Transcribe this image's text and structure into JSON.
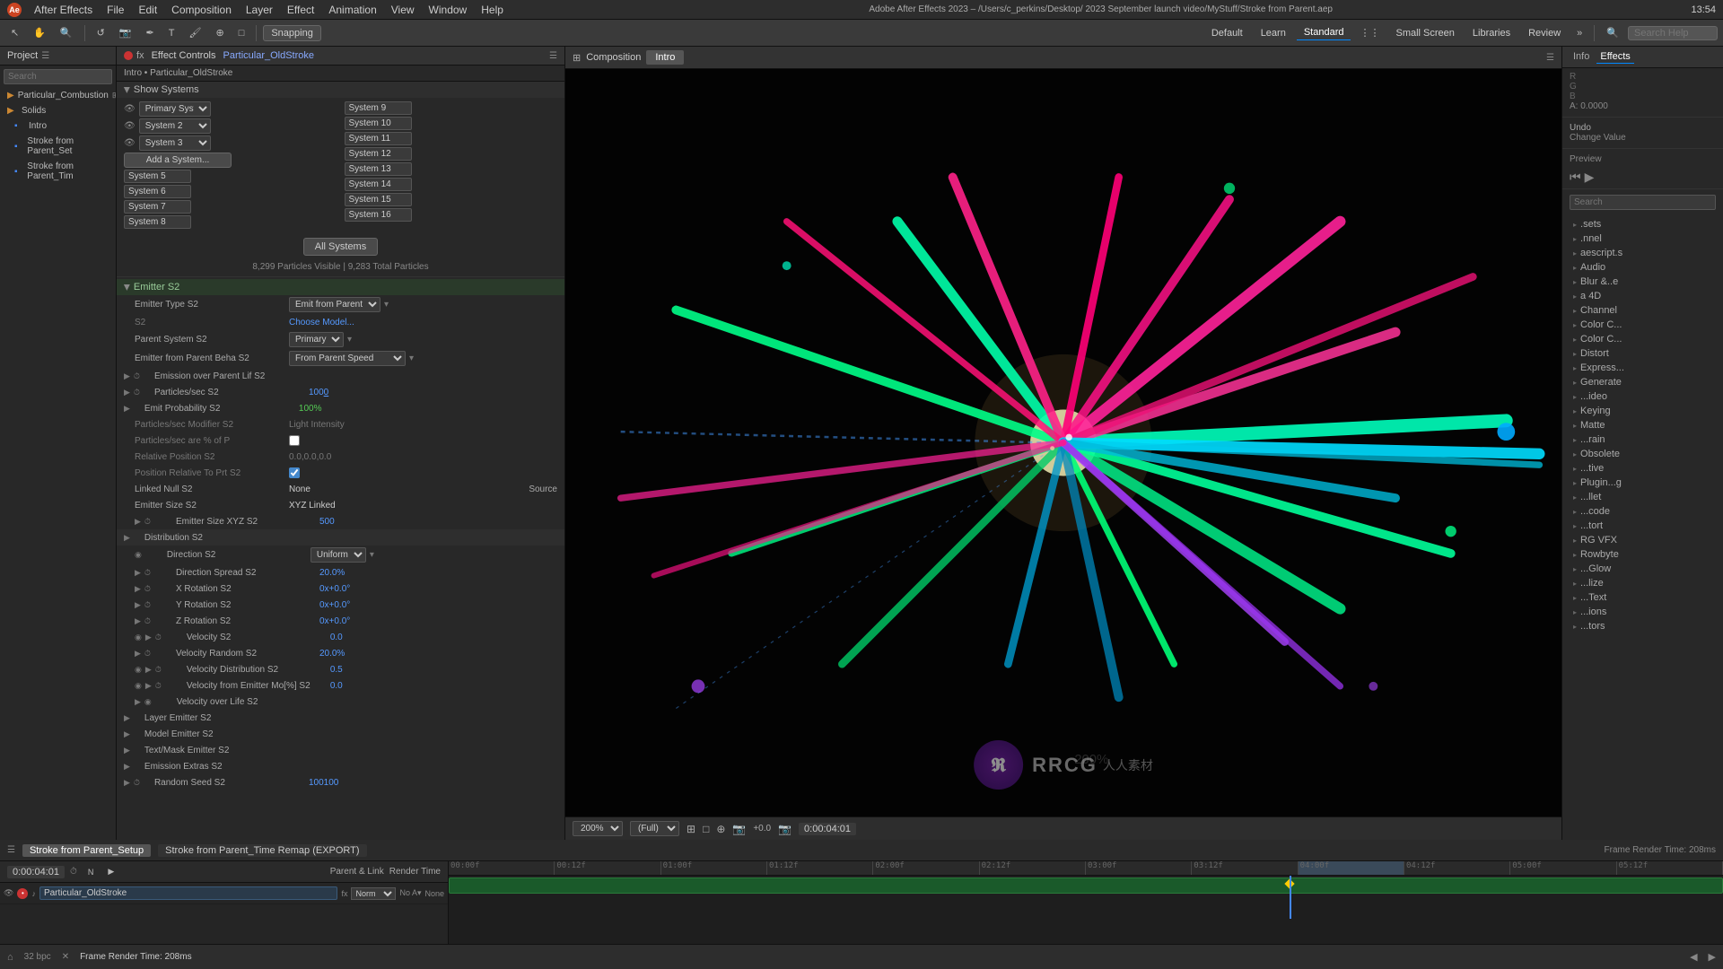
{
  "app": {
    "name": "Adobe After Effects 2023",
    "version": "AE",
    "title": "Adobe After Effects 2023 – /Users/c_perkins/Desktop/ 2023 September launch video/MyStuff/Stroke from Parent.aep",
    "time": "13:54"
  },
  "menubar": {
    "items": [
      "After Effects",
      "File",
      "Edit",
      "Composition",
      "Layer",
      "Effect",
      "Animation",
      "View",
      "Window",
      "Help"
    ]
  },
  "toolbar": {
    "snapping": "Snapping",
    "workspaces": [
      "Default",
      "Learn",
      "Standard",
      "Small Screen",
      "Libraries",
      "Review"
    ],
    "active_workspace": "Standard",
    "search_placeholder": "Search Help"
  },
  "project_panel": {
    "title": "Project",
    "search_placeholder": "Search",
    "items": [
      {
        "name": "Particular_Combustion",
        "type": "folder",
        "icon": "📁"
      },
      {
        "name": "Solids",
        "type": "folder",
        "icon": "📁"
      },
      {
        "name": "Intro",
        "type": "comp",
        "icon": "🎬"
      },
      {
        "name": "Stroke from Parent_Set",
        "type": "comp",
        "icon": "🎬"
      },
      {
        "name": "Stroke from Parent_Tim",
        "type": "comp",
        "icon": "🎬"
      }
    ]
  },
  "effect_controls": {
    "title": "Effect Controls",
    "layer": "Particular_OldStroke",
    "subtitle": "Intro • Particular_OldStroke",
    "show_systems_label": "Show Systems",
    "systems": [
      {
        "name": "Primary System",
        "dropdown": "System 9",
        "eye": true
      },
      {
        "name": "System 2",
        "dropdown": "System 10",
        "eye": true
      },
      {
        "name": "System 3",
        "dropdown": "System 11",
        "eye": true
      },
      {
        "name": "Add a System...",
        "dropdown": "System 12",
        "add": true
      },
      {
        "name": "System 5",
        "dropdown": "System 13"
      },
      {
        "name": "System 6",
        "dropdown": "System 14"
      },
      {
        "name": "System 7",
        "dropdown": "System 15"
      },
      {
        "name": "System 8",
        "dropdown": "System 16"
      }
    ],
    "all_systems_btn": "All Systems",
    "particle_info": "8,299 Particles Visible | 9,283 Total Particles",
    "emitter_s2": {
      "header": "Emitter S2",
      "rows": [
        {
          "label": "Emitter Type S2",
          "value": "Emit from Parent",
          "type": "dropdown",
          "indent": 1
        },
        {
          "label": "",
          "value": "Choose Model...",
          "type": "link",
          "indent": 1
        },
        {
          "label": "Parent System S2",
          "value": "Primary",
          "type": "dropdown",
          "indent": 1
        },
        {
          "label": "Emitter from Parent Beha S2",
          "value": "From Parent Speed",
          "type": "dropdown",
          "indent": 1
        },
        {
          "label": "Emission over Parent Lif S2",
          "type": "expand",
          "indent": 1
        },
        {
          "label": "Particles/sec S2",
          "value": "1000",
          "type": "value-blue",
          "indent": 1,
          "stopwatch": true
        },
        {
          "label": "Emit Probability S2",
          "value": "100%",
          "type": "value-green",
          "indent": 1
        },
        {
          "label": "Particles/sec Modifier S2",
          "value": "Light Intensity",
          "type": "dimmed",
          "indent": 1
        },
        {
          "label": "Particles/sec are % of P",
          "value": "",
          "type": "checkbox",
          "indent": 1
        },
        {
          "label": "Relative Position S2",
          "value": "0.0,0.0,0.0",
          "type": "dimmed",
          "indent": 1
        },
        {
          "label": "Position Relative To Prt S2",
          "value": "",
          "type": "checkbox-checked",
          "indent": 1
        },
        {
          "label": "Linked Null S2",
          "value": "None",
          "extra": "Source",
          "type": "dual",
          "indent": 1
        },
        {
          "label": "Emitter Size S2",
          "value": "XYZ Linked",
          "type": "value",
          "indent": 1
        },
        {
          "label": "Emitter Size XYZ S2",
          "value": "500",
          "type": "expand",
          "indent": 2
        },
        {
          "label": "Distribution S2",
          "type": "header-row",
          "indent": 1
        },
        {
          "label": "Direction S2",
          "value": "Uniform",
          "type": "dropdown",
          "indent": 2
        },
        {
          "label": "Direction Spread S2",
          "value": "20.0%",
          "type": "value-blue",
          "indent": 2,
          "stopwatch": true
        },
        {
          "label": "X Rotation S2",
          "value": "0x+0.0°",
          "type": "value-blue",
          "indent": 2,
          "stopwatch": true
        },
        {
          "label": "Y Rotation S2",
          "value": "0x+0.0°",
          "type": "value-blue",
          "indent": 2,
          "stopwatch": true
        },
        {
          "label": "Z Rotation S2",
          "value": "0x+0.0°",
          "type": "value-blue",
          "indent": 2,
          "stopwatch": true
        },
        {
          "label": "Velocity S2",
          "value": "0.0",
          "type": "value-blue",
          "indent": 2,
          "stopwatch": true
        },
        {
          "label": "Velocity Random S2",
          "value": "20.0%",
          "type": "value-blue",
          "indent": 2,
          "stopwatch": true
        },
        {
          "label": "Velocity Distribution S2",
          "value": "0.5",
          "type": "value-blue",
          "indent": 2,
          "stopwatch": true
        },
        {
          "label": "Velocity from Emitter Mo[%] S2",
          "value": "0.0",
          "type": "value-blue",
          "indent": 2,
          "stopwatch": true
        },
        {
          "label": "Velocity over Life S2",
          "type": "expand",
          "indent": 2
        },
        {
          "label": "Layer Emitter S2",
          "type": "expand",
          "indent": 1
        },
        {
          "label": "Model Emitter S2",
          "type": "expand",
          "indent": 1
        },
        {
          "label": "Text/Mask Emitter S2",
          "type": "expand",
          "indent": 1
        },
        {
          "label": "Emission Extras S2",
          "type": "expand",
          "indent": 1
        },
        {
          "label": "Random Seed S2",
          "value": "100100",
          "type": "value-blue",
          "indent": 1,
          "stopwatch": true
        }
      ]
    }
  },
  "composition": {
    "title": "Composition",
    "tab": "Intro",
    "zoom": "200%",
    "quality": "(Full)",
    "timecode": "0:00:04:01",
    "render_time_label": "Render Time"
  },
  "effects_panel": {
    "title": "Effects",
    "info_tabs": [
      "Info",
      "Effects"
    ],
    "active_tab": "Effects",
    "rgba": {
      "r": "R",
      "g": "G",
      "b": "B",
      "a": "A: 0.0000"
    },
    "undo_label": "Undo",
    "change_value_label": "Change Value",
    "preview_label": "Preview",
    "search_placeholder": "Search",
    "effects": [
      ".sets",
      ".nnel",
      "aescript.s",
      "Audio",
      "Blur &..e",
      "a 4D",
      "Channel",
      "Color C...",
      "Color C...",
      "Distort",
      "Express...",
      "Generate",
      "...ideo",
      "Keying",
      "Matte",
      "...rain",
      "Obsolete",
      "...tive",
      "Plugin...g",
      "...llet",
      "...code",
      "...tort",
      "RG VFX",
      "Rowbyte",
      "...Glow",
      "...lize",
      "...Text",
      "...ions",
      "...tors"
    ]
  },
  "timeline": {
    "tabs": [
      "Stroke from Parent_Setup",
      "Stroke from Parent_Time Remap (EXPORT)"
    ],
    "active_tab": 0,
    "timecode": "0:00:04:01",
    "layer_name": "Particular_OldStroke",
    "ruler_marks": [
      "00:00f",
      "00:12f",
      "01:00f",
      "01:12f",
      "02:00f",
      "02:12f",
      "03:00f",
      "03:12f",
      "04:00f",
      "04:12f",
      "05:00f",
      "05:12f"
    ],
    "render_time": "Frame Render Time: 208ms"
  },
  "statusbar": {
    "render_time": "Frame Render Time: 208ms"
  },
  "colors": {
    "accent_blue": "#0088ff",
    "accent_green": "#55cc55",
    "panel_bg": "#282828",
    "timeline_bar": "#1a6b35"
  }
}
